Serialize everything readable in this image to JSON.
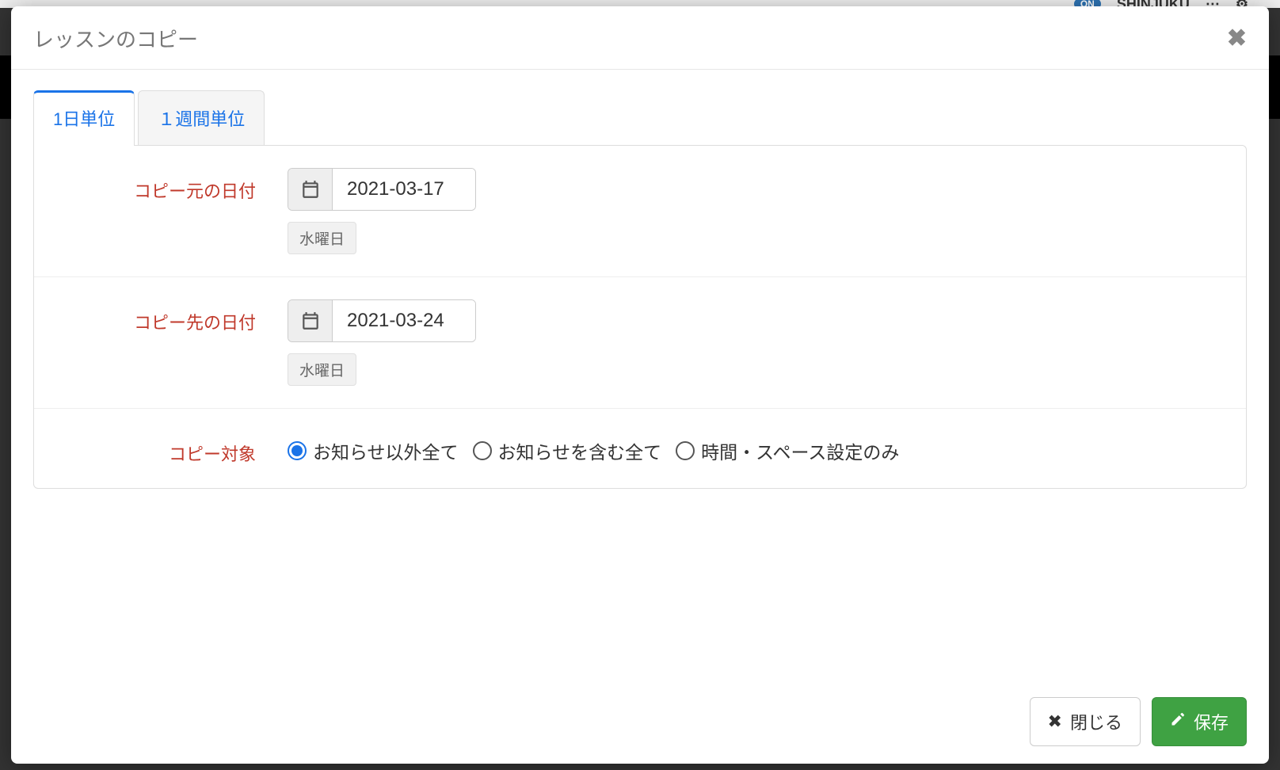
{
  "bg": {
    "on_label": "ON",
    "location": "SHINJUKU"
  },
  "modal": {
    "title": "レッスンのコピー",
    "tabs": [
      {
        "label": "1日単位",
        "active": true
      },
      {
        "label": "１週間単位",
        "active": false
      }
    ],
    "form": {
      "source_date": {
        "label": "コピー元の日付",
        "value": "2021-03-17",
        "weekday": "水曜日"
      },
      "dest_date": {
        "label": "コピー先の日付",
        "value": "2021-03-24",
        "weekday": "水曜日"
      },
      "copy_target": {
        "label": "コピー対象",
        "options": [
          {
            "label": "お知らせ以外全て",
            "checked": true
          },
          {
            "label": "お知らせを含む全て",
            "checked": false
          },
          {
            "label": "時間・スペース設定のみ",
            "checked": false
          }
        ]
      }
    },
    "footer": {
      "close_label": "閉じる",
      "save_label": "保存"
    }
  }
}
